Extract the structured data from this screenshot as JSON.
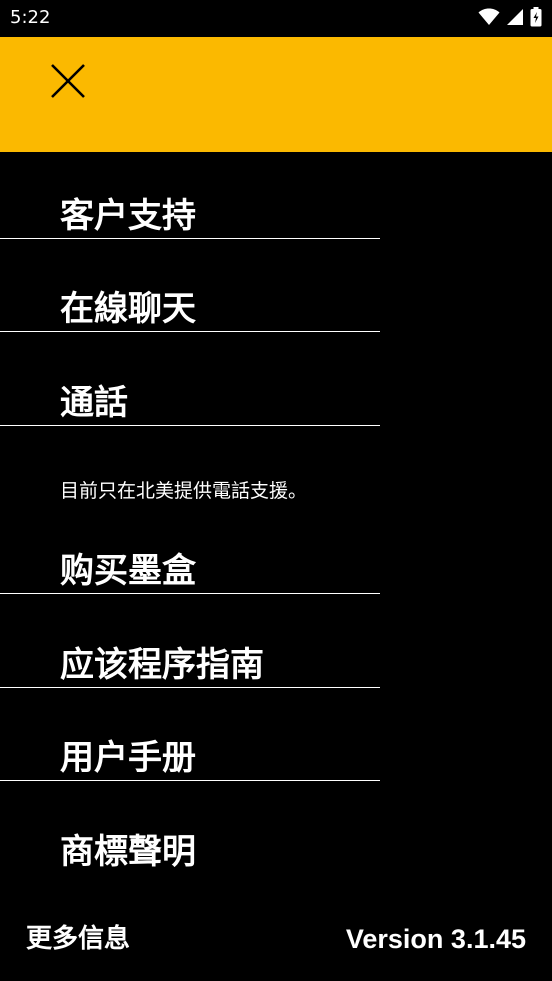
{
  "status_bar": {
    "time": "5:22",
    "icons": [
      "wifi-icon",
      "cellular-signal-icon",
      "battery-charging-icon"
    ]
  },
  "header": {
    "background_color": "#FBB900",
    "close_icon": "close-icon"
  },
  "menu": {
    "items": [
      {
        "label": "客户支持"
      },
      {
        "label": "在線聊天"
      },
      {
        "label": "通話"
      },
      {
        "label": "购买墨盒"
      },
      {
        "label": "应该程序指南"
      },
      {
        "label": "用户手册"
      },
      {
        "label": "商標聲明"
      }
    ],
    "note": "目前只在北美提供電話支援。"
  },
  "footer": {
    "more_info": "更多信息",
    "version": "Version 3.1.45"
  }
}
